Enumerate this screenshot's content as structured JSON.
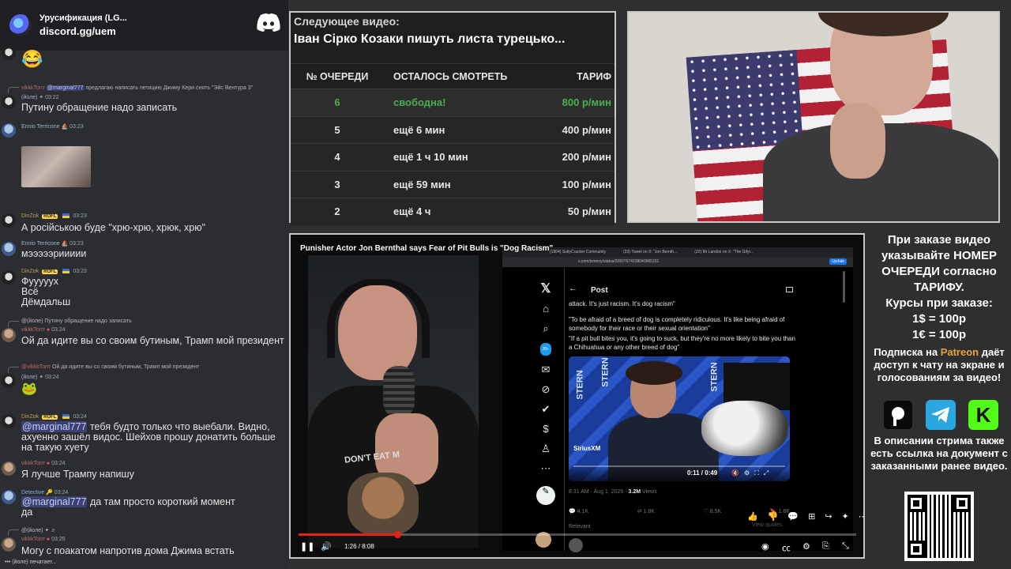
{
  "chat": {
    "server_name": "Урусификация (LG...",
    "server_link": "discord.gg/uem",
    "typing": "(йоле) печатает...",
    "messages": [
      {
        "kind": "emoji",
        "emoji": "😂"
      },
      {
        "reply_name": "vikkkTorrr",
        "reply_mention": "@marginal777",
        "reply_text": "предлагаю написать петицию Джиму Кери снять \"Эйс Вентура 3\"",
        "name": "(йоле)",
        "time": "03:22",
        "text": "Путину обращение надо записать"
      },
      {
        "name": "Ennio Terricone",
        "time": "03:23",
        "image": true
      },
      {
        "name": "DinZok",
        "tag": "ROFL",
        "time": "03:23",
        "text": "А російською буде \"хрю-хрю, хрюк, хрю\""
      },
      {
        "name": "Ennio Terricone",
        "time": "03:23",
        "text": "мэээээриииии"
      },
      {
        "name": "DinZok",
        "tag": "ROFL",
        "time": "03:23",
        "text1": "Фууууух",
        "text2": "Всё",
        "text3": "Дёмдальш"
      },
      {
        "reply_name": "@(йоле)",
        "reply_text": "Путину обращение надо записать",
        "name": "vikkkTorrr",
        "time": "03:24",
        "text": "Ой да идите вы со своим бутиным, Трамп мой президент"
      },
      {
        "reply_name": "@vikkkTorrr",
        "reply_text": "Ой да идите вы со своим бутиным, Трамп мой президент",
        "name": "(йоле)",
        "time": "03:24",
        "emoji": "🐸"
      },
      {
        "name": "DinZok",
        "tag": "ROFL",
        "time": "03:24",
        "mention": "@marginal777",
        "text": " тебя будто только что выебали. Видно, ахуенно зашёл видос. Шейхов прошу донатить больше на такую хуету"
      },
      {
        "name": "vikkkTorrr",
        "time": "03:24",
        "text": "Я лучше Трампу напишу"
      },
      {
        "name": "Detective",
        "time": "03:24",
        "mention": "@marginal777",
        "text": " да там просто короткий момент",
        "text2": "да"
      },
      {
        "reply_name": "@(йоле)",
        "reply_text": "",
        "name": "vikkkTorrr",
        "time": "03:25",
        "text": "Могу с поакатом напротив дома Джима встать"
      }
    ]
  },
  "queue": {
    "next_label": "Следующее видео:",
    "next_title": "Іван Сірко Козаки пишуть листа турецько...",
    "headers": [
      "№ ОЧЕРЕДИ",
      "ОСТАЛОСЬ СМОТРЕТЬ",
      "ТАРИФ"
    ],
    "rows": [
      {
        "num": "6",
        "left": "свободна!",
        "price": "800 р/мин"
      },
      {
        "num": "5",
        "left": "ещё 6 мин",
        "price": "400 р/мин"
      },
      {
        "num": "4",
        "left": "ещё 1 ч 10 мин",
        "price": "200 р/мин"
      },
      {
        "num": "3",
        "left": "ещё 59 мин",
        "price": "100 р/мин"
      },
      {
        "num": "2",
        "left": "ещё 4 ч",
        "price": "50 р/мин"
      }
    ],
    "accent_color": "#4caf50"
  },
  "video": {
    "title": "Punisher Actor Jon Bernthal says Fear of Pit Bulls is \"Dog Racism\"",
    "time": "1:26 / 8:08",
    "progress": 0.177,
    "shirt_text": "DON'T EAT M",
    "browser": {
      "tabs": [
        "(1804) SultyCracker Community",
        "(33) Tweet on X: \"Jon Bernth...",
        "(22) Mr Landon on X: \"The Gifyr..."
      ],
      "url": "x.com/jvmeny/status/20837674238040665231",
      "update": "Update"
    },
    "post": {
      "header": "Post",
      "p1": "attack. It's just racism. It's dog racism\"",
      "p2": "\"To be afraid of a breed of dog is completely ridiculous. It's like being afraid of somebody for their race or their sexual orientation\"",
      "p3": "\"If a pit bull bites you, it's going to suck, but they're no more likely to bite you than a Chihuahua or any other breed of dog\"",
      "video_time": "0:11 / 0:49",
      "video_logo": "SiriusXM",
      "stern_word": "STERN",
      "date": "8:31 AM · Aug 1, 2026 ·",
      "views_num": "3.2M",
      "views_label": "Views",
      "replies": "4.1K",
      "reposts": "1.8K",
      "likes": "8.5K",
      "bookmarks": "1.8K",
      "relevant": "Relevant",
      "view_quotes": "View quotes"
    }
  },
  "info": {
    "order_text": "При заказе видео указывайте НОМЕР ОЧЕРЕДИ согласно ТАРИФУ.",
    "rates_title": "Курсы при заказе:",
    "rate_usd": "1$ = 100р",
    "rate_eur": "1€ = 100р",
    "sub_prefix": "Подписка на ",
    "sub_link": "Patreon",
    "sub_suffix": " даёт доступ к чату на экране и голосованиям за видео!",
    "desc": "В описании стрима также есть ссылка на документ с заказанными ранее видео.",
    "kick_letter": "K",
    "patreon_color": "#e8a33a"
  }
}
